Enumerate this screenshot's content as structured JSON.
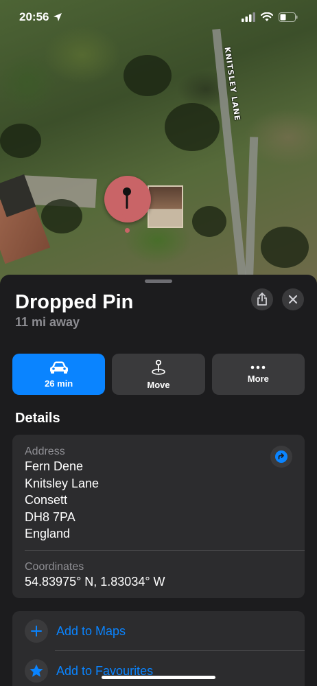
{
  "status_bar": {
    "time": "20:56"
  },
  "map": {
    "road_label": "KNITSLEY LANE"
  },
  "place": {
    "title": "Dropped Pin",
    "distance": "11 mi away"
  },
  "actions": [
    {
      "label": "26 min",
      "icon": "car-icon"
    },
    {
      "label": "Move",
      "icon": "pin-move-icon"
    },
    {
      "label": "More",
      "icon": "ellipsis-icon"
    }
  ],
  "details": {
    "section_title": "Details",
    "address_label": "Address",
    "address_lines": [
      "Fern Dene",
      "Knitsley Lane",
      "Consett",
      "DH8 7PA",
      "England"
    ],
    "coordinates_label": "Coordinates",
    "coordinates": "54.83975° N, 1.83034° W"
  },
  "list": [
    {
      "label": "Add to Maps",
      "icon": "plus-icon"
    },
    {
      "label": "Add to Favourites",
      "icon": "star-icon"
    }
  ],
  "colors": {
    "accent": "#0a84ff",
    "pin": "#c96467",
    "sheet_bg": "#1c1c1e",
    "card_bg": "#2c2c2e"
  }
}
